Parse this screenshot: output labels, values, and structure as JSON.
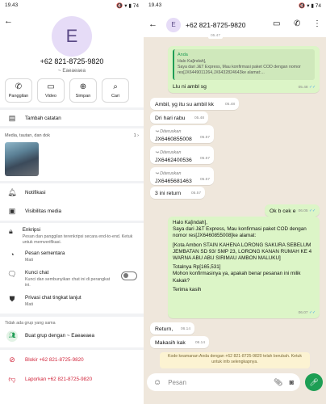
{
  "left": {
    "status": {
      "time": "19.43",
      "icons": "✉ ◎ • ",
      "right_icons": "🔇 ▾ ▮ 74"
    },
    "avatar_letter": "E",
    "phone": "+62 821-8725-9820",
    "name": "~ Eaeaeaea",
    "actions": [
      {
        "label": "Panggilan",
        "icon": "phone-icon"
      },
      {
        "label": "Video",
        "icon": "video-icon"
      },
      {
        "label": "Simpan",
        "icon": "add-person-icon"
      },
      {
        "label": "Cari",
        "icon": "search-icon"
      }
    ],
    "add_note": "Tambah catatan",
    "media_label": "Media, tautan, dan dok",
    "media_count": "1",
    "notifications": "Notifikasi",
    "media_visibility": "Visibilitas media",
    "encryption_title": "Enkripsi",
    "encryption_sub": "Pesan dan panggilan terenkripsi secara end-to-end. Ketuk untuk memverifikasi.",
    "disappearing_title": "Pesan sementara",
    "disappearing_sub": "Mati",
    "lock_title": "Kunci chat",
    "lock_sub": "Kunci dan sembunyikan chat ini di perangkat ini.",
    "privacy_title": "Privasi chat tingkat lanjut",
    "privacy_sub": "Mati",
    "no_groups": "Tidak ada grup yang sama",
    "create_group": "Buat grup dengan ~ Eaeaeaea",
    "block": "Blokir +62 821-8725-9820",
    "report": "Laporkan +62 821-8725-9820"
  },
  "right": {
    "status": {
      "time": "19.43",
      "icons": "✉ ◎ • ",
      "right_icons": "🔇 ▾ ▮ 74"
    },
    "header": {
      "avatar_letter": "E",
      "title": "+62 821-8725-9820"
    },
    "top_time": "05.47",
    "msg1": {
      "quote_name": "Anda",
      "quote_text": "Halo Ka[indah],\nSaya dari J&T Express, Mau konfirmasi paket COD dengan nomor res[JX6449011264,JX6432824643ke alamat:...",
      "text": "Llu ni ambl sg",
      "time": "05.48"
    },
    "msg2": {
      "text": "Ambil, yg itu su ambil kk",
      "time": "05.48"
    },
    "msg3": {
      "text": "Dri hari rabu",
      "time": "05.48"
    },
    "fwd1": {
      "label": "Diteruskan",
      "text": "JX6460855008",
      "time": "05.57"
    },
    "fwd2": {
      "label": "Diteruskan",
      "text": "JX6462400536",
      "time": "05.57"
    },
    "fwd3": {
      "label": "Diteruskan",
      "text": "JX6465681463",
      "time": "05.57"
    },
    "msg4": {
      "text": "3 ini return",
      "time": "05.57"
    },
    "msg5": {
      "text": "Ok b cek e",
      "time": "06.05"
    },
    "msg6": {
      "l1": "Halo Ka[indah],",
      "l2": "Saya dari J&T Express, Mau konfirmasi paket COD dengan nomor res[JX6460855008]ke alamat:",
      "l3": "[Kota Ambon  STAIN KAHENA LORONG SAKURA SEBELUM JEMBATAN SD 93/ SMP 23, LORONG KANAN RUMAH KE 4 WARNA ABU ABU SIRIMAU AMBON MALUKU]",
      "l4": "Totalnya Rp[165,531]",
      "l5": "Mohon konfirmasinya ya, apakah benar pesanan ini milik Kakak?",
      "l6": "Terima kasih",
      "time": "06.07"
    },
    "msg7": {
      "text": "Return,",
      "time": "06.14"
    },
    "msg8": {
      "text": "Makasih kak",
      "time": "06.14"
    },
    "security": "Kode keamanan Anda dengan +62 821-8725-9820 telah berubah. Ketuk untuk info selengkapnya.",
    "input_placeholder": "Pesan"
  }
}
